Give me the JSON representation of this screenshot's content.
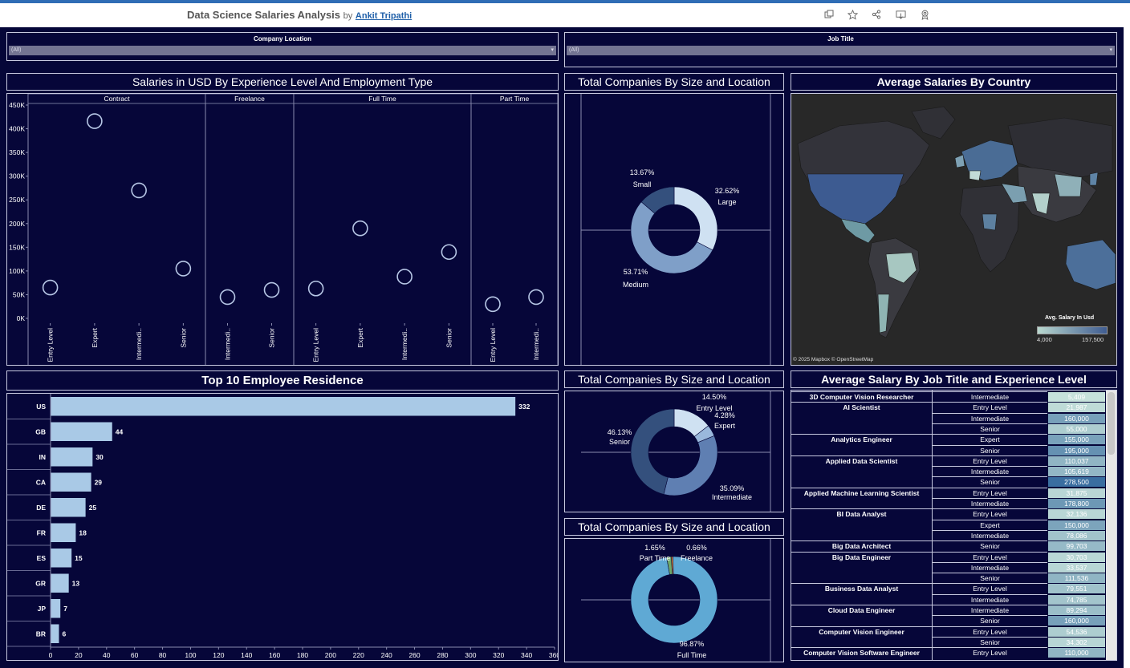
{
  "header": {
    "title": "Data Science Salaries Analysis",
    "by": "by",
    "author": "Ankit Tripathi",
    "icons": [
      "duplicate-icon",
      "favorite-icon",
      "share-icon",
      "download-icon",
      "badge-icon"
    ]
  },
  "filters": {
    "company_location": {
      "label": "Company Location",
      "value": "(All)"
    },
    "job_title": {
      "label": "Job Title",
      "value": "(All)"
    }
  },
  "salaries_chart": {
    "title": "Salaries in USD By Experience Level And Employment Type",
    "panels": [
      "Contract",
      "Freelance",
      "Full Time",
      "Part Time"
    ],
    "y_ticks": [
      "450K",
      "400K",
      "350K",
      "300K",
      "250K",
      "200K",
      "150K",
      "100K",
      "50K",
      "0K"
    ]
  },
  "company_size": {
    "title": "Total Companies By Size and Location",
    "labels": [
      {
        "pct": "13.67%",
        "name": "Small"
      },
      {
        "pct": "32.62%",
        "name": "Large"
      },
      {
        "pct": "53.71%",
        "name": "Medium"
      }
    ]
  },
  "avg_country": {
    "title": "Average Salaries By Country",
    "legend_title": "Avg. Salary In Usd",
    "legend_min": "4,000",
    "legend_max": "157,500",
    "attribution": "© 2025 Mapbox  © OpenStreetMap"
  },
  "residence": {
    "title": "Top 10 Employee Residence",
    "x_ticks": [
      "0",
      "20",
      "40",
      "60",
      "80",
      "100",
      "120",
      "140",
      "160",
      "180",
      "200",
      "220",
      "240",
      "260",
      "280",
      "300",
      "320",
      "340",
      "360"
    ]
  },
  "experience_donut": {
    "title": "Total Companies By Size and Location",
    "labels": [
      {
        "pct": "14.50%",
        "name": "Entry Level"
      },
      {
        "pct": "4.28%",
        "name": "Expert"
      },
      {
        "pct": "46.13%",
        "name": "Senior"
      },
      {
        "pct": "35.09%",
        "name": "Intermediate"
      }
    ]
  },
  "employment_donut": {
    "title": "Total Companies By Size and Location",
    "labels": [
      {
        "pct": "1.65%",
        "name": "Part Time"
      },
      {
        "pct": "0.66%",
        "name": "Freelance"
      },
      {
        "pct": "96.87%",
        "name": "Full Time"
      }
    ]
  },
  "job_table": {
    "title": "Average Salary By Job Title and Experience Level",
    "rows": [
      {
        "job": "3D Computer Vision Researcher",
        "level": "Intermediate",
        "value": "5,409"
      },
      {
        "job": "AI Scientist",
        "level": "Entry Level",
        "value": "21,987"
      },
      {
        "job": "",
        "level": "Intermediate",
        "value": "160,000"
      },
      {
        "job": "",
        "level": "Senior",
        "value": "55,000"
      },
      {
        "job": "Analytics Engineer",
        "level": "Expert",
        "value": "155,000"
      },
      {
        "job": "",
        "level": "Senior",
        "value": "195,000"
      },
      {
        "job": "Applied Data Scientist",
        "level": "Entry Level",
        "value": "110,037"
      },
      {
        "job": "",
        "level": "Intermediate",
        "value": "105,619"
      },
      {
        "job": "",
        "level": "Senior",
        "value": "278,500"
      },
      {
        "job": "Applied Machine Learning Scientist",
        "level": "Entry Level",
        "value": "31,875"
      },
      {
        "job": "",
        "level": "Intermediate",
        "value": "178,800"
      },
      {
        "job": "BI Data Analyst",
        "level": "Entry Level",
        "value": "32,136"
      },
      {
        "job": "",
        "level": "Expert",
        "value": "150,000"
      },
      {
        "job": "",
        "level": "Intermediate",
        "value": "78,086"
      },
      {
        "job": "Big Data Architect",
        "level": "Senior",
        "value": "99,703"
      },
      {
        "job": "Big Data Engineer",
        "level": "Entry Level",
        "value": "30,703"
      },
      {
        "job": "",
        "level": "Intermediate",
        "value": "33,537"
      },
      {
        "job": "",
        "level": "Senior",
        "value": "111,536"
      },
      {
        "job": "Business Data Analyst",
        "level": "Entry Level",
        "value": "79,551"
      },
      {
        "job": "",
        "level": "Intermediate",
        "value": "74,785"
      },
      {
        "job": "Cloud Data Engineer",
        "level": "Intermediate",
        "value": "89,294"
      },
      {
        "job": "",
        "level": "Senior",
        "value": "160,000"
      },
      {
        "job": "Computer Vision Engineer",
        "level": "Entry Level",
        "value": "54,536"
      },
      {
        "job": "",
        "level": "Senior",
        "value": "34,302"
      },
      {
        "job": "Computer Vision Software Engineer",
        "level": "Entry Level",
        "value": "110,000"
      }
    ]
  },
  "chart_data": [
    {
      "type": "scatter",
      "title": "Salaries in USD By Experience Level And Employment Type",
      "ylim": [
        0,
        450000
      ],
      "panels": [
        {
          "name": "Contract",
          "categories": [
            "Entry Level",
            "Expert",
            "Intermedi..",
            "Senior"
          ],
          "values": [
            65000,
            416000,
            270000,
            105000
          ]
        },
        {
          "name": "Freelance",
          "categories": [
            "Intermedi..",
            "Senior"
          ],
          "values": [
            45000,
            60000
          ]
        },
        {
          "name": "Full Time",
          "categories": [
            "Entry Level",
            "Expert",
            "Intermedi..",
            "Senior"
          ],
          "values": [
            63000,
            190000,
            88000,
            140000
          ]
        },
        {
          "name": "Part Time",
          "categories": [
            "Entry Level",
            "Intermedi.."
          ],
          "values": [
            30000,
            45000
          ]
        }
      ]
    },
    {
      "type": "pie",
      "title": "Total Companies By Size and Location",
      "categories": [
        "Large",
        "Medium",
        "Small"
      ],
      "values": [
        32.62,
        53.71,
        13.67
      ],
      "colors": [
        "#cfe1f2",
        "#7f9fc8",
        "#34507d"
      ]
    },
    {
      "type": "bar",
      "title": "Top 10 Employee Residence",
      "categories": [
        "US",
        "GB",
        "IN",
        "CA",
        "DE",
        "FR",
        "ES",
        "GR",
        "JP",
        "BR"
      ],
      "values": [
        332,
        44,
        30,
        29,
        25,
        18,
        15,
        13,
        7,
        6
      ],
      "xlim": [
        0,
        360
      ]
    },
    {
      "type": "pie",
      "title": "Total Companies By Size and Location",
      "categories": [
        "Entry Level",
        "Expert",
        "Intermediate",
        "Senior"
      ],
      "values": [
        14.5,
        4.28,
        35.09,
        46.13
      ],
      "colors": [
        "#cfe1f2",
        "#9ab8dc",
        "#5f7fb2",
        "#34507d"
      ]
    },
    {
      "type": "pie",
      "title": "Total Companies By Size and Location",
      "categories": [
        "Freelance",
        "Full Time",
        "Part Time"
      ],
      "values": [
        0.66,
        96.87,
        1.65
      ],
      "colors": [
        "#e58a3c",
        "#5fa9d4",
        "#6fa86a"
      ]
    }
  ]
}
